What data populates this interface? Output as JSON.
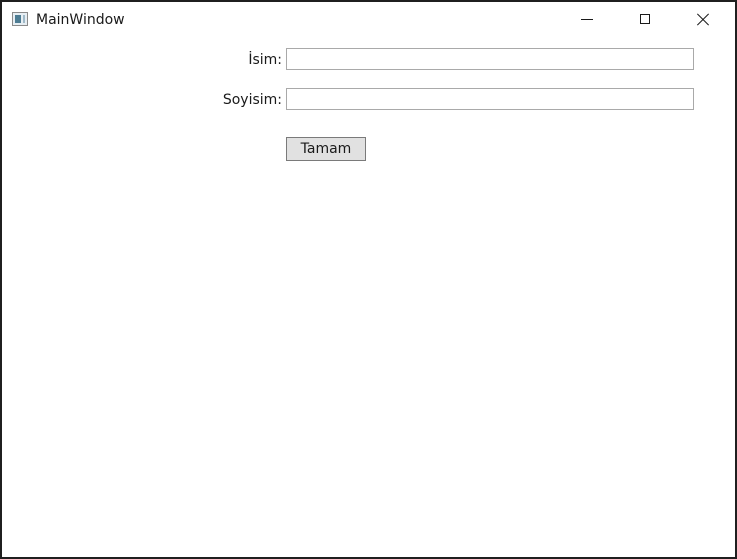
{
  "window": {
    "title": "MainWindow",
    "app_icon": "window-app-icon",
    "caption_buttons": {
      "minimize_icon": "minimize-icon",
      "maximize_icon": "maximize-icon",
      "close_icon": "close-icon"
    }
  },
  "form": {
    "first_name_label": "İsim:",
    "first_name_value": "",
    "last_name_label": "Soyisim:",
    "last_name_value": "",
    "ok_button_label": "Tamam"
  },
  "colors": {
    "window_border": "#1f1f1f",
    "button_background": "#e1e1e1",
    "textbox_border": "#a9a9a9"
  }
}
